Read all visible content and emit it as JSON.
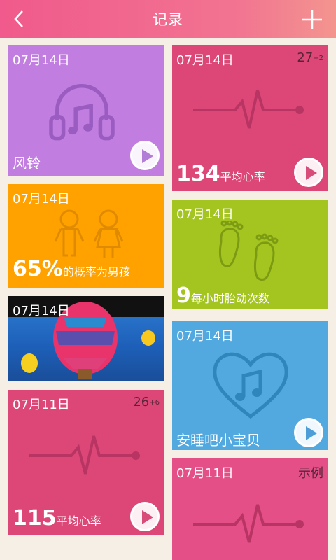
{
  "header": {
    "title": "记录",
    "back_icon": "chevron-left-icon",
    "add_icon": "plus-icon"
  },
  "cards": {
    "music_left": {
      "date": "07月14日",
      "label": "风铃",
      "color": "#c17ee0",
      "icon": "headphones-icon"
    },
    "heart_top": {
      "date": "07月14日",
      "count": "27",
      "count_sup": "+2",
      "value": "134",
      "label": "平均心率",
      "color": "#dc4777",
      "icon": "heartbeat-icon"
    },
    "boy_prob": {
      "date": "07月14日",
      "value": "65%",
      "label": "的概率为男孩",
      "color": "#ffa200",
      "icon": "kids-icon"
    },
    "kicks": {
      "date": "07月14日",
      "value": "9",
      "label": "每小时胎动次数",
      "color": "#a4c520",
      "icon": "footprints-icon"
    },
    "photo": {
      "date": "07月14日",
      "icon": "balloon-photo"
    },
    "lullaby": {
      "date": "07月14日",
      "label": "安睡吧小宝贝",
      "color": "#52a9e0",
      "icon": "heart-music-icon"
    },
    "heart_bottom": {
      "date": "07月11日",
      "count": "26",
      "count_sup": "+6",
      "value": "115",
      "label": "平均心率",
      "color": "#dc4777",
      "icon": "heartbeat-icon"
    },
    "sample": {
      "date": "07月11日",
      "badge": "示例",
      "color": "#e34f86",
      "icon": "heartbeat-icon"
    }
  }
}
